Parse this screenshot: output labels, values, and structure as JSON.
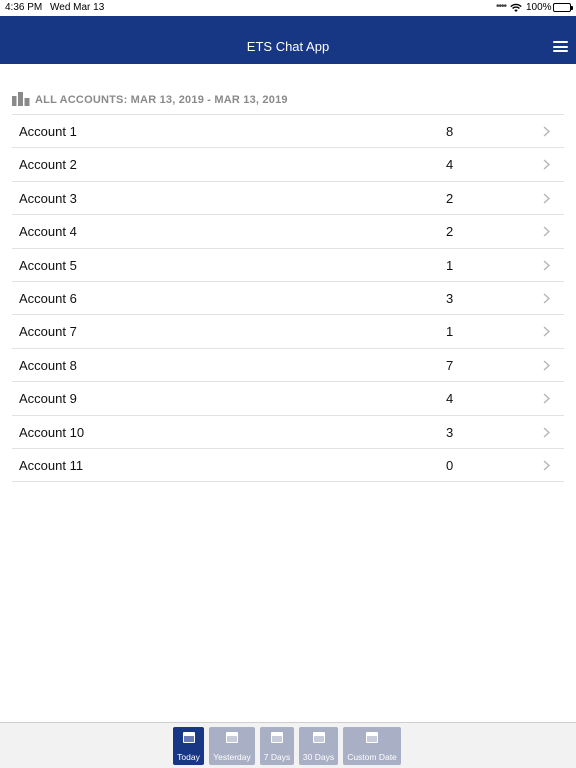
{
  "status_bar": {
    "time": "4:36 PM",
    "date": "Wed Mar 13",
    "battery_percent": "100%",
    "battery_level": 1.0
  },
  "navbar": {
    "title": "ETS Chat App",
    "background": "#173684"
  },
  "section": {
    "header": "ALL ACCOUNTS: MAR 13, 2019 -  MAR 13, 2019"
  },
  "accounts": [
    {
      "name": "Account 1",
      "count": "8"
    },
    {
      "name": "Account 2",
      "count": "4"
    },
    {
      "name": "Account 3",
      "count": "2"
    },
    {
      "name": "Account 4",
      "count": "2"
    },
    {
      "name": "Account 5",
      "count": "1"
    },
    {
      "name": "Account 6",
      "count": "3"
    },
    {
      "name": "Account 7",
      "count": "1"
    },
    {
      "name": "Account 8",
      "count": "7"
    },
    {
      "name": "Account 9",
      "count": "4"
    },
    {
      "name": "Account 10",
      "count": "3"
    },
    {
      "name": "Account 11",
      "count": "0"
    }
  ],
  "tabs": [
    {
      "label": "Today",
      "active": true
    },
    {
      "label": "Yesterday",
      "active": false
    },
    {
      "label": "7 Days",
      "active": false
    },
    {
      "label": "30 Days",
      "active": false
    },
    {
      "label": "Custom Date",
      "active": false
    }
  ]
}
